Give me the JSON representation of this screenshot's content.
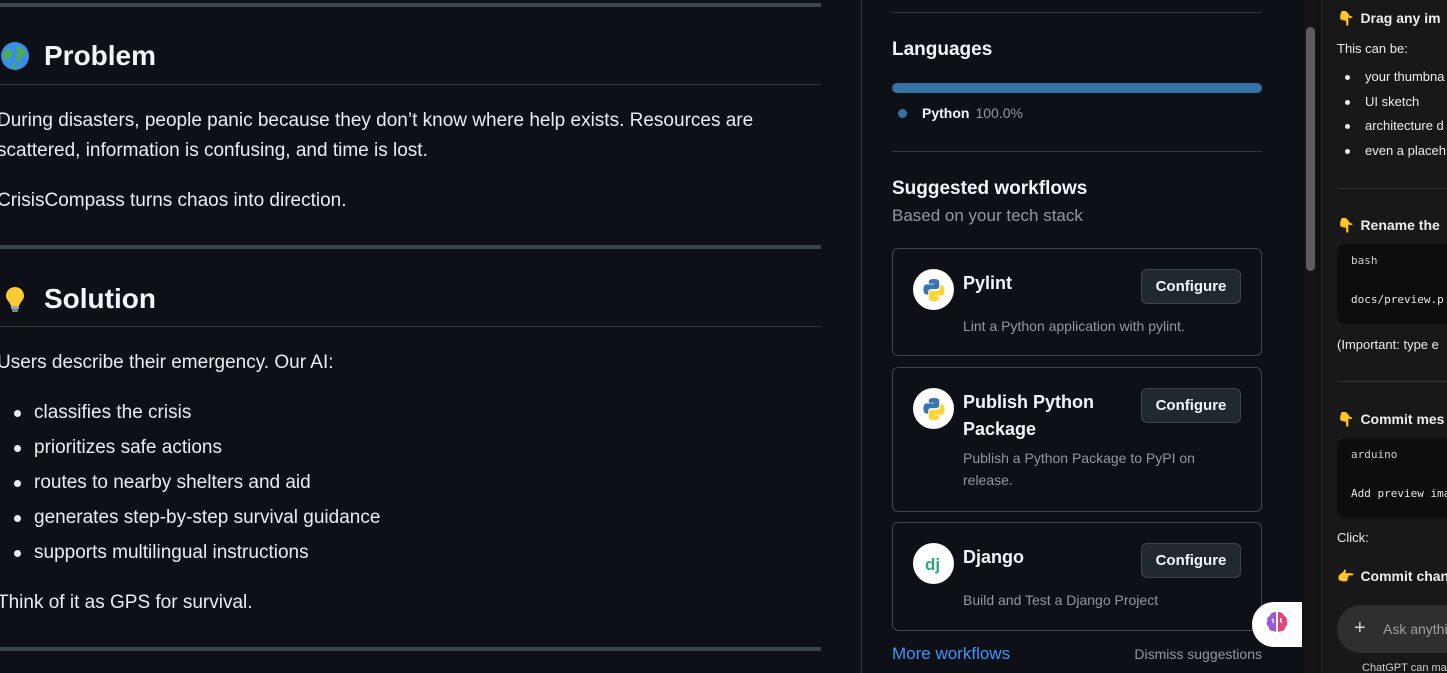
{
  "readme": {
    "problem": {
      "emoji": "🌍",
      "title": "Problem",
      "paragraphs": [
        "During disasters, people panic because they don’t know where help exists. Resources are",
        "scattered, information is confusing, and time is lost."
      ],
      "tagline": "CrisisCompass turns chaos into direction."
    },
    "solution": {
      "emoji": "💡",
      "title": "Solution",
      "intro": "Users describe their emergency. Our AI:",
      "bullets": [
        "classifies the crisis",
        "prioritizes safe actions",
        "routes to nearby shelters and aid",
        "generates step-by-step survival guidance",
        "supports multilingual instructions"
      ],
      "closing": "Think of it as GPS for survival."
    }
  },
  "sidebar": {
    "languages": {
      "heading": "Languages",
      "items": [
        {
          "name": "Python",
          "percent": "100.0%",
          "share": 1.0,
          "color": "#3572A5"
        }
      ]
    },
    "workflows": {
      "heading": "Suggested workflows",
      "subheading": "Based on your tech stack",
      "cards": [
        {
          "title": "Pylint",
          "description": "Lint a Python application with pylint.",
          "button": "Configure",
          "icon": "python-logo-icon"
        },
        {
          "title": "Publish Python Package",
          "description": "Publish a Python Package to PyPI on release.",
          "button": "Configure",
          "icon": "python-logo-icon"
        },
        {
          "title": "Django",
          "description": "Build and Test a Django Project",
          "button": "Configure",
          "icon": "django-logo-icon"
        }
      ],
      "more_link": "More workflows",
      "dismiss": "Dismiss suggestions"
    }
  },
  "chat": {
    "drag_heading": "Drag any im",
    "can_be": "This can be:",
    "can_be_items": [
      "your thumbna",
      "UI sketch",
      "architecture d",
      "even a placeh"
    ],
    "rename_heading": "Rename the",
    "rename_code": {
      "lang": "bash",
      "code": "docs/preview.p"
    },
    "important_note": "(Important: type e",
    "commit_heading": "Commit mes",
    "commit_code": {
      "lang": "arduino",
      "code": "Add preview ima"
    },
    "click_label": "Click:",
    "commit_changes": "Commit chang",
    "input_placeholder": "Ask anythi",
    "disclaimer": "ChatGPT can ma"
  }
}
